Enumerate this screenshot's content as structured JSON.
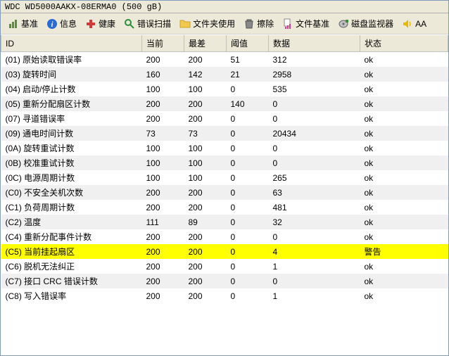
{
  "window": {
    "title": "WDC WD5000AAKX-08ERMA0 (500 gB)"
  },
  "toolbar": {
    "benchmark": "基准",
    "info": "信息",
    "health": "健康",
    "errorscan": "错误扫描",
    "folderusage": "文件夹使用",
    "erase": "擦除",
    "filebench": "文件基准",
    "diskmonitor": "磁盘监视器",
    "aam": "AA"
  },
  "headers": {
    "id": "ID",
    "current": "当前",
    "worst": "最差",
    "threshold": "阈值",
    "data": "数据",
    "status": "状态"
  },
  "status_labels": {
    "ok": "ok",
    "warn": "警告"
  },
  "rows": [
    {
      "id": "(01) 原始读取错误率",
      "cur": "200",
      "worst": "200",
      "thr": "51",
      "data": "312",
      "status": "ok"
    },
    {
      "id": "(03) 旋转时间",
      "cur": "160",
      "worst": "142",
      "thr": "21",
      "data": "2958",
      "status": "ok"
    },
    {
      "id": "(04) 启动/停止计数",
      "cur": "100",
      "worst": "100",
      "thr": "0",
      "data": "535",
      "status": "ok"
    },
    {
      "id": "(05) 重新分配扇区计数",
      "cur": "200",
      "worst": "200",
      "thr": "140",
      "data": "0",
      "status": "ok"
    },
    {
      "id": "(07) 寻道错误率",
      "cur": "200",
      "worst": "200",
      "thr": "0",
      "data": "0",
      "status": "ok"
    },
    {
      "id": "(09) 通电时间计数",
      "cur": "73",
      "worst": "73",
      "thr": "0",
      "data": "20434",
      "status": "ok"
    },
    {
      "id": "(0A) 旋转重试计数",
      "cur": "100",
      "worst": "100",
      "thr": "0",
      "data": "0",
      "status": "ok"
    },
    {
      "id": "(0B) 校准重试计数",
      "cur": "100",
      "worst": "100",
      "thr": "0",
      "data": "0",
      "status": "ok"
    },
    {
      "id": "(0C) 电源周期计数",
      "cur": "100",
      "worst": "100",
      "thr": "0",
      "data": "265",
      "status": "ok"
    },
    {
      "id": "(C0) 不安全关机次数",
      "cur": "200",
      "worst": "200",
      "thr": "0",
      "data": "63",
      "status": "ok"
    },
    {
      "id": "(C1) 负荷周期计数",
      "cur": "200",
      "worst": "200",
      "thr": "0",
      "data": "481",
      "status": "ok"
    },
    {
      "id": "(C2) 温度",
      "cur": "111",
      "worst": "89",
      "thr": "0",
      "data": "32",
      "status": "ok"
    },
    {
      "id": "(C4) 重新分配事件计数",
      "cur": "200",
      "worst": "200",
      "thr": "0",
      "data": "0",
      "status": "ok"
    },
    {
      "id": "(C5) 当前挂起扇区",
      "cur": "200",
      "worst": "200",
      "thr": "0",
      "data": "4",
      "status": "warn"
    },
    {
      "id": "(C6) 脱机无法纠正",
      "cur": "200",
      "worst": "200",
      "thr": "0",
      "data": "1",
      "status": "ok"
    },
    {
      "id": "(C7) 接口 CRC 错误计数",
      "cur": "200",
      "worst": "200",
      "thr": "0",
      "data": "0",
      "status": "ok"
    },
    {
      "id": "(C8) 写入错误率",
      "cur": "200",
      "worst": "200",
      "thr": "0",
      "data": "1",
      "status": "ok"
    }
  ]
}
